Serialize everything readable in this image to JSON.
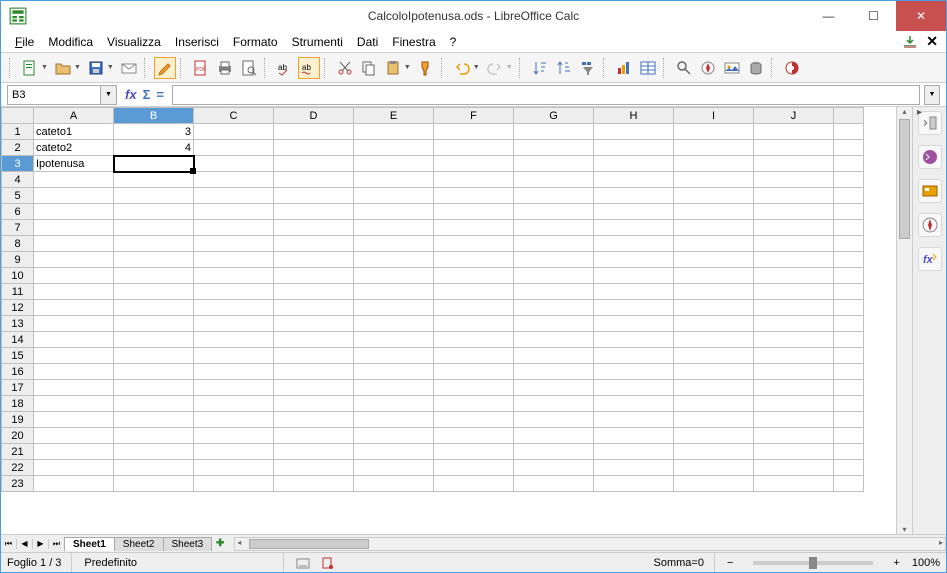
{
  "window": {
    "title": "CalcoloIpotenusa.ods - LibreOffice Calc"
  },
  "menu": {
    "file": "File",
    "modifica": "Modifica",
    "visualizza": "Visualizza",
    "inserisci": "Inserisci",
    "formato": "Formato",
    "strumenti": "Strumenti",
    "dati": "Dati",
    "finestra": "Finestra",
    "help": "?"
  },
  "formula_bar": {
    "name_box": "B3",
    "fx": "fx",
    "sigma": "Σ",
    "eq": "="
  },
  "columns": [
    "A",
    "B",
    "C",
    "D",
    "E",
    "F",
    "G",
    "H",
    "I",
    "J"
  ],
  "rows_count": 23,
  "selected": {
    "col": "B",
    "row": 3
  },
  "cells": {
    "A1": "cateto1",
    "B1": "3",
    "A2": "cateto2",
    "B2": "4",
    "A3": "Ipotenusa"
  },
  "tabs": {
    "sheets": [
      "Sheet1",
      "Sheet2",
      "Sheet3"
    ],
    "active": 0
  },
  "status": {
    "foglio": "Foglio 1 / 3",
    "style": "Predefinito",
    "sum": "Somma=0",
    "zoom": "100%",
    "minus": "−",
    "plus": "+"
  }
}
